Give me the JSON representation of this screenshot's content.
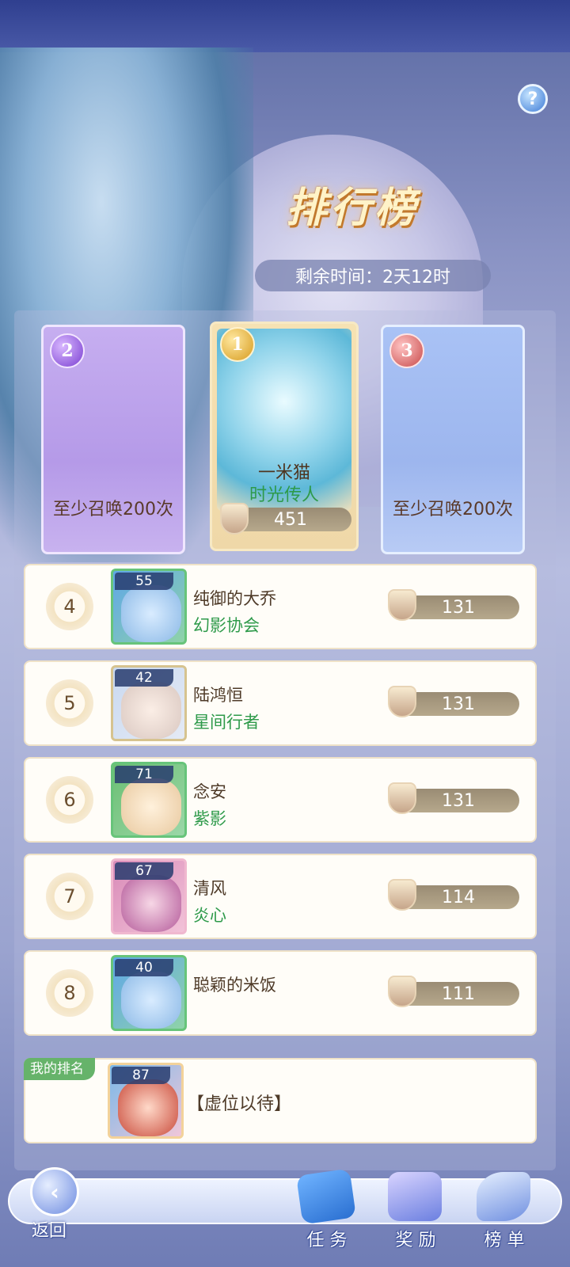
{
  "help": {
    "icon": "?"
  },
  "title": "排行榜",
  "timer": "剩余时间：2天12时",
  "podium": {
    "first": {
      "rank": "1",
      "name": "一米猫",
      "guild": "时光传人",
      "score": "451"
    },
    "second": {
      "rank": "2",
      "requirement": "至少召唤200次"
    },
    "third": {
      "rank": "3",
      "requirement": "至少召唤200次"
    }
  },
  "rows": [
    {
      "rank": "4",
      "level": "55",
      "name": "纯御的大乔",
      "guild": "幻影协会",
      "score": "131"
    },
    {
      "rank": "5",
      "level": "42",
      "name": "陆鸿恒",
      "guild": "星间行者",
      "score": "131"
    },
    {
      "rank": "6",
      "level": "71",
      "name": "念安",
      "guild": "紫影",
      "score": "131"
    },
    {
      "rank": "7",
      "level": "67",
      "name": "清风",
      "guild": "炎心",
      "score": "114"
    },
    {
      "rank": "8",
      "level": "40",
      "name": "聪颖的米饭",
      "guild": "",
      "score": "111"
    }
  ],
  "my_rank": {
    "tag": "我的排名",
    "level": "87",
    "name": "【虚位以待】"
  },
  "nav": {
    "back": "返回",
    "tasks": "任 务",
    "rewards": "奖 励",
    "ranking": "榜 单"
  },
  "colors": {
    "guild_green": "#2e9a4a",
    "accent_gold": "#d79b1e",
    "nav_blue": "#3a4f9a"
  }
}
